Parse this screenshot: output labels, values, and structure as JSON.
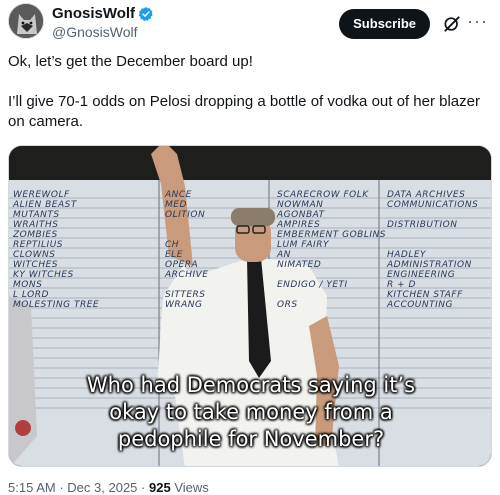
{
  "author": {
    "display_name": "GnosisWolf",
    "handle": "@GnosisWolf"
  },
  "actions": {
    "subscribe_label": "Subscribe",
    "grok_icon": "grok-icon",
    "more_icon": "more-icon"
  },
  "tweet": {
    "line1": "Ok, let’s get the December board up!",
    "line2": "I’ll give 70-1 odds on Pelosi dropping a bottle of vodka out of her blazer on camera."
  },
  "media": {
    "caption_line1": "Who had Democrats saying it’s",
    "caption_line2": "okay to take money from a",
    "caption_line3": "pedophile for November?",
    "board_left": [
      "WEREWOLF",
      "ALIEN BEAST",
      "MUTANTS",
      "WRAITHS",
      "ZOMBIES",
      "REPTILIUS",
      "CLOWNS",
      "WITCHES",
      "KY WITCHES",
      "MONS",
      "L LORD",
      "MOLESTING TREE"
    ],
    "board_mid": [
      "ANCE",
      "MED",
      "OLITION",
      "",
      "",
      "CH",
      "ELE",
      "OPERA",
      "ARCHIVE",
      "",
      "SITTERS",
      "WRANG"
    ],
    "board_right_a": [
      "SCARECROW FOLK",
      "NOWMAN",
      "AGONBAT",
      "AMPIRES",
      "EMBERMENT GOBLINS",
      "LUM FAIRY",
      "AN",
      "NIMATED",
      "",
      "ENDIGO / YETI",
      "",
      "ORS"
    ],
    "board_right_b": [
      "DATA ARCHIVES",
      "COMMUNICATIONS",
      "",
      "DISTRIBUTION",
      "",
      "",
      "HADLEY",
      "ADMINISTRATION",
      "ENGINEERING",
      "R + D",
      "KITCHEN STAFF",
      "ACCOUNTING"
    ]
  },
  "meta": {
    "time": "5:15 AM",
    "separator": "·",
    "date": "Dec 3, 2025",
    "views_count": "925",
    "views_label": "Views"
  }
}
